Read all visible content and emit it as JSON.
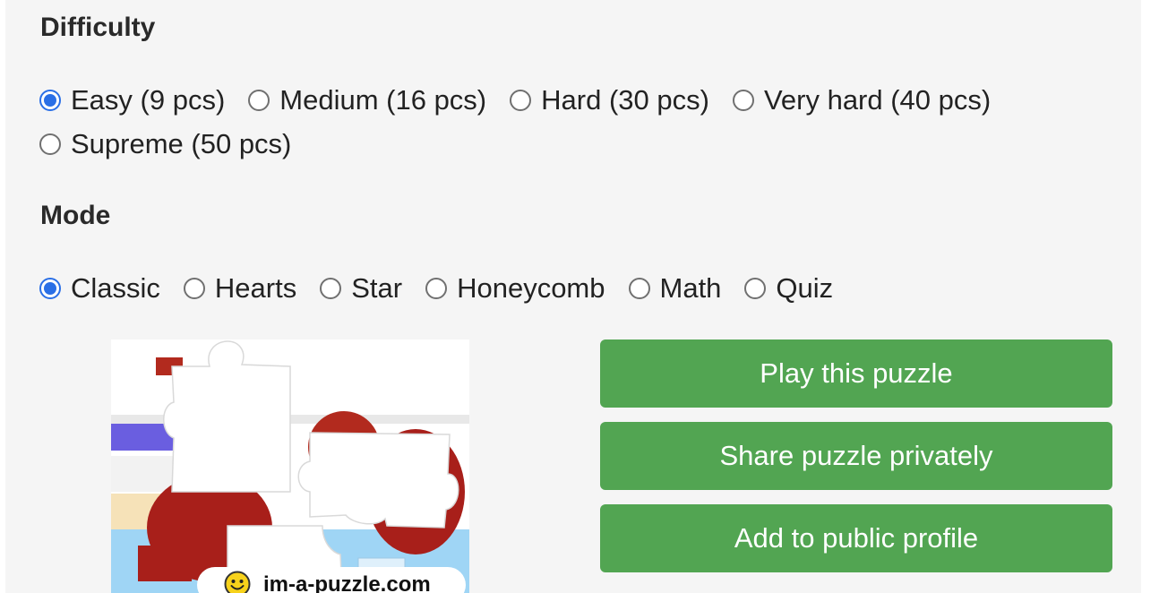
{
  "difficulty": {
    "heading": "Difficulty",
    "options": [
      {
        "label": "Easy (9 pcs)",
        "checked": true
      },
      {
        "label": "Medium (16 pcs)",
        "checked": false
      },
      {
        "label": "Hard (30 pcs)",
        "checked": false
      },
      {
        "label": "Very hard (40 pcs)",
        "checked": false
      },
      {
        "label": "Supreme (50 pcs)",
        "checked": false
      }
    ]
  },
  "mode": {
    "heading": "Mode",
    "options": [
      {
        "label": "Classic",
        "checked": true
      },
      {
        "label": "Hearts",
        "checked": false
      },
      {
        "label": "Star",
        "checked": false
      },
      {
        "label": "Honeycomb",
        "checked": false
      },
      {
        "label": "Math",
        "checked": false
      },
      {
        "label": "Quiz",
        "checked": false
      }
    ]
  },
  "preview": {
    "watermark": "im-a-puzzle.com",
    "icon": "smiley-icon"
  },
  "actions": {
    "play_label": "Play this puzzle",
    "share_label": "Share puzzle privately",
    "add_label": "Add to public profile"
  },
  "colors": {
    "accent_green": "#52a552",
    "radio_blue": "#2a6fe6",
    "panel_bg": "#f5f5f5"
  }
}
